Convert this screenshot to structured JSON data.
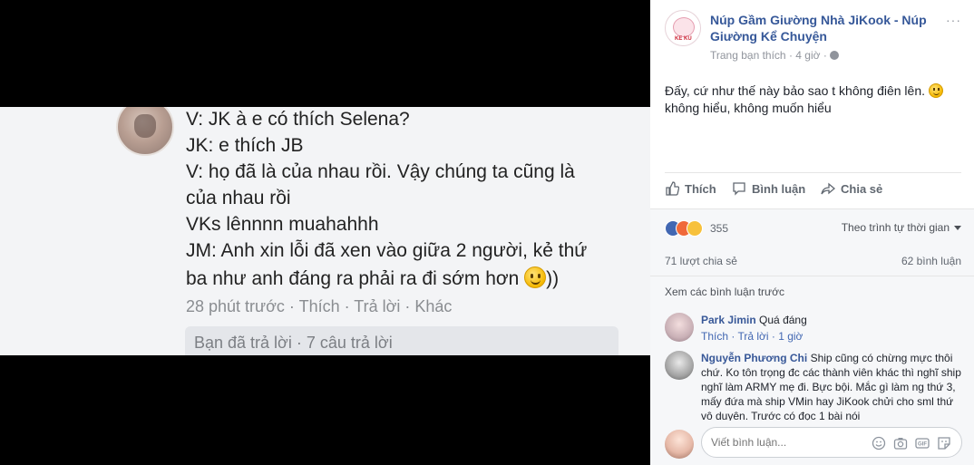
{
  "photo": {
    "lines": [
      "V: JK à e có thích Selena?",
      "JK: e thích JB",
      "V: họ đã là của nhau rồi. Vậy chúng ta cũng là",
      "của nhau rồi",
      "VKs lênnnn muahahhh",
      "JM: Anh xin lỗi đã xen vào giữa 2 người, kẻ thứ",
      "ba như anh đáng ra phải ra đi sớm hơn",
      "))"
    ],
    "meta": "28 phút trước · Thích · Trả lời · Khác",
    "reply_box": "Bạn đã trả lời · 7 câu trả lời"
  },
  "post": {
    "page_name": "Núp Gầm Giường Nhà JiKook - Núp Giường Kể Chuyện",
    "page_avatar_text": "KE KU",
    "meta": "Trang bạn thích · 4 giờ ·",
    "text_line1": "Đấy, cứ như thế này bảo sao t không điên lên.",
    "text_line2": "không hiểu, không muốn hiểu",
    "more": "···",
    "actions": {
      "like": "Thích",
      "comment": "Bình luận",
      "share": "Chia sẻ"
    }
  },
  "stats": {
    "reaction_count": "355",
    "sort_label": "Theo trình tự thời gian",
    "shares": "71 lượt chia sẻ",
    "comments": "62 bình luận",
    "view_previous": "Xem các bình luận trước"
  },
  "comments": [
    {
      "author": "Park Jimin",
      "text": "Quá đáng",
      "actions": "Thích · Trả lời · 1 giờ"
    },
    {
      "author": "Nguyễn Phương Chi",
      "text": "Ship cũng có chừng mực thôi chứ. Ko tôn trọng đc các thành viên khác thì nghĩ ship nghĩ làm ARMY mẹ đi. Bực bội. Mắc gì làm ng thứ 3, mấy đứa mà ship VMin hay JiKook chửi cho sml thứ vô duyên. Trước có đọc 1 bài nói"
    }
  ],
  "composer": {
    "placeholder": "Viết bình luận...",
    "icons": [
      "emoji-icon",
      "camera-icon",
      "gif-icon",
      "sticker-icon"
    ],
    "gif_label": "GIF"
  },
  "colors": {
    "link_blue": "#365899",
    "like_blue": "#4267b2",
    "muted": "#90949c"
  }
}
